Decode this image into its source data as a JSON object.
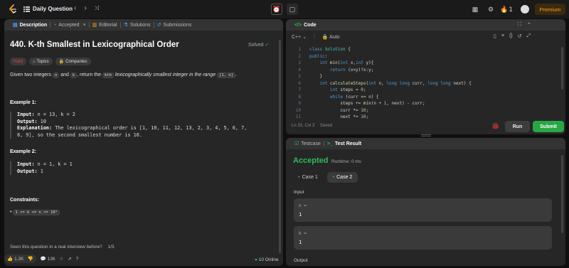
{
  "topbar": {
    "problem_list": "Daily Question",
    "streak": "1",
    "premium": "Premium"
  },
  "left_panel": {
    "tabs": [
      "Description",
      "Accepted",
      "Editorial",
      "Solutions",
      "Submissions"
    ],
    "title": "440. K-th Smallest in Lexicographical Order",
    "solved": "Solved",
    "difficulty": "Hard",
    "topics": "Topics",
    "companies": "Companies",
    "statement_pre": "Given two integers",
    "var_n": "n",
    "and": "and",
    "var_k": "k",
    "statement_mid": ", return the",
    "kth": "kth",
    "statement_italic": "lexicographically smallest integer in the range",
    "range": "[1, n]",
    "period": ".",
    "example1_title": "Example 1:",
    "example1_input_label": "Input:",
    "example1_input": "n = 13, k = 2",
    "example1_output_label": "Output:",
    "example1_output": "10",
    "example1_expl_label": "Explanation:",
    "example1_expl_line1": "The lexicographical order is [1, 10, 11, 12, 13, 2, 3, 4, 5, 6, 7,",
    "example1_expl_line2": "8, 9], so the second smallest number is 10.",
    "example2_title": "Example 2:",
    "example2_input_label": "Input:",
    "example2_input": "n = 1, k = 1",
    "example2_output_label": "Output:",
    "example2_output": "1",
    "constraints_title": "Constraints:",
    "constraint1": "1 <= k <= n <= 10⁹",
    "seen_question": "Seen this question in a real interview before?",
    "seen_pages": "1/5",
    "likes": "1.3K",
    "comments": "136",
    "online": "10 Online"
  },
  "code_panel": {
    "title": "Code",
    "language": "C++",
    "auto": "Auto",
    "status": "Ln 33, Col 3",
    "saved": "Saved",
    "run": "Run",
    "submit": "Submit",
    "lines": [
      {
        "n": "1",
        "t": "class Solution {"
      },
      {
        "n": "2",
        "t": "public:"
      },
      {
        "n": "3",
        "t": "    int min(int x,int y){"
      },
      {
        "n": "4",
        "t": "        return (x<y)?x:y;"
      },
      {
        "n": "5",
        "t": "    }"
      },
      {
        "n": "6",
        "t": "    int calculateSteps(int n, long long curr, long long next) {"
      },
      {
        "n": "7",
        "t": "        int steps = 0;"
      },
      {
        "n": "8",
        "t": "        while (curr <= n) {"
      },
      {
        "n": "9",
        "t": "            steps += min(n + 1, next) - curr;"
      },
      {
        "n": "10",
        "t": "            curr *= 10;"
      },
      {
        "n": "11",
        "t": "            next *= 10;"
      }
    ]
  },
  "result_panel": {
    "tab_testcase": "Testcase",
    "tab_result": "Test Result",
    "status": "Accepted",
    "runtime": "Runtime: 0 ms",
    "case1": "Case 1",
    "case2": "Case 2",
    "input_label": "Input",
    "param1_label": "n =",
    "param1_value": "1",
    "param2_label": "k =",
    "param2_value": "1",
    "output_label": "Output"
  },
  "colors": {
    "accent_orange": "#ffa116",
    "hard_red": "#f63737",
    "accepted_green": "#2cbb5d",
    "submit_green": "#28a745",
    "background": "#0f0f0f",
    "panel": "#262626"
  }
}
